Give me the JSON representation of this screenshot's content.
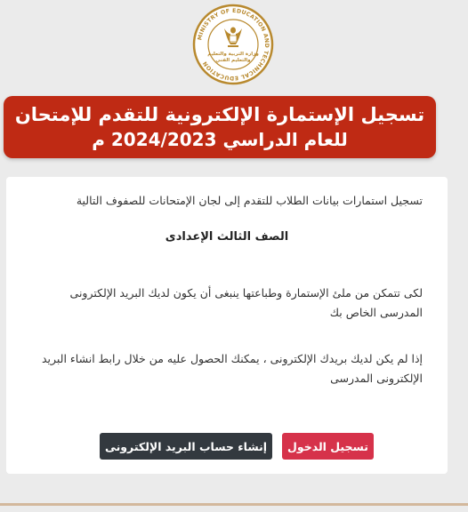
{
  "logo": {
    "ring_text": "MINISTRY OF EDUCATION AND TECHNICAL EDUCATION",
    "center_text": "وزارة التربية والتعليم والتعليم الفني"
  },
  "banner": {
    "line1": "تسجيل الإستمارة الإلكترونية للتقدم للإمتحان",
    "line2": "للعام الدراسي 2024/2023 م"
  },
  "card": {
    "intro": "تسجيل استمارات بيانات الطلاب للتقدم إلى لجان الإمتحانات للصفوف التالية",
    "grade": "الصف الثالث الإعدادى",
    "para1": "لكى تتمكن من ملئ الإستمارة وطباعتها ينبغى أن يكون لديك البريد الإلكترونى المدرسى الخاص بك",
    "para2": "إذا لم يكن لديك بريدك الإلكترونى ، يمكنك الحصول عليه من خلال رابط انشاء البريد الإلكترونى المدرسى"
  },
  "buttons": {
    "login_label": "تسجيل الدخول",
    "create_label": "إنشاء حساب البريد الإلكترونى"
  },
  "colors": {
    "banner": "#bf2a14",
    "login_button": "#d6324a",
    "create_button": "#33393f",
    "logo_gold": "#b8892e"
  }
}
